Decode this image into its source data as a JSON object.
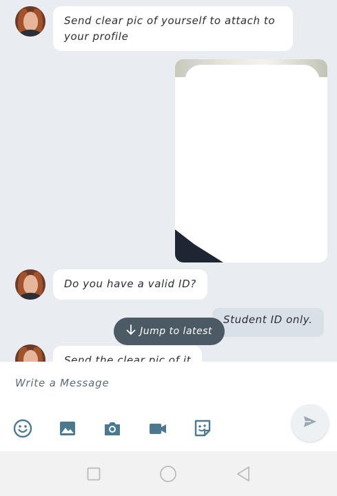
{
  "messages": [
    {
      "from": "them",
      "text": "Send clear pic of yourself to attach to your profile"
    },
    {
      "from": "me",
      "type": "image"
    },
    {
      "from": "them",
      "text": "Do you have a valid ID?"
    },
    {
      "from": "me",
      "text": "Student ID only."
    },
    {
      "from": "them",
      "text": "Send the clear pic of it"
    }
  ],
  "jump": {
    "label": "Jump to latest"
  },
  "composer": {
    "placeholder": "Write a Message"
  },
  "toolbar": {
    "icons": [
      "emoji-icon",
      "gallery-icon",
      "camera-icon",
      "video-icon",
      "sticker-icon"
    ],
    "send_icon": "send-icon"
  },
  "nav": {
    "icons": [
      "recents-icon",
      "home-icon",
      "back-icon"
    ]
  },
  "colors": {
    "accent": "#4b7a8f",
    "bubble_out": "#d9e0e6",
    "bubble_in": "#ffffff",
    "chat_bg": "#e9ecf0"
  }
}
